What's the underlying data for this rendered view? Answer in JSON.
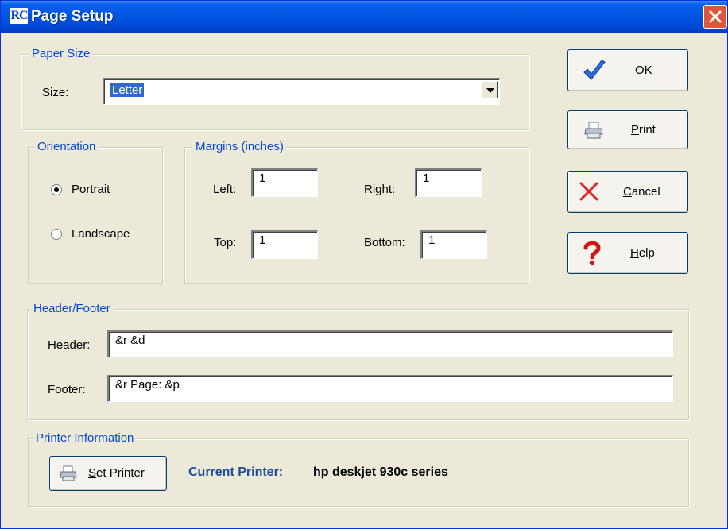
{
  "window": {
    "title": "Page Setup",
    "app_icon_text": "RC",
    "colors": {
      "titlebar": "#0054e3",
      "dialog_bg": "#ece9d8",
      "group_label": "#0046d5",
      "close": "#e0563a"
    }
  },
  "paper_size": {
    "legend": "Paper Size",
    "size_label": "Size:",
    "size_value": "Letter"
  },
  "orientation": {
    "legend": "Orientation",
    "options": [
      {
        "label": "Portrait",
        "selected": true
      },
      {
        "label": "Landscape",
        "selected": false
      }
    ]
  },
  "margins": {
    "legend": "Margins (inches)",
    "left_label": "Left:",
    "left_value": "1",
    "right_label": "Right:",
    "right_value": "1",
    "top_label": "Top:",
    "top_value": "1",
    "bottom_label": "Bottom:",
    "bottom_value": "1"
  },
  "header_footer": {
    "legend": "Header/Footer",
    "header_label": "Header:",
    "header_value": "&r &d",
    "footer_label": "Footer:",
    "footer_value": "&r Page: &p"
  },
  "printer_info": {
    "legend": "Printer Information",
    "set_printer_mnemonic": "S",
    "set_printer_rest": "et Printer",
    "current_label": "Current Printer:",
    "current_value": "hp deskjet 930c series"
  },
  "buttons": {
    "ok": {
      "mnemonic": "O",
      "rest": "K",
      "icon": "checkmark-icon"
    },
    "print": {
      "mnemonic": "P",
      "rest": "rint",
      "icon": "printer-icon"
    },
    "cancel": {
      "mnemonic": "C",
      "rest": "ancel",
      "icon": "x-icon"
    },
    "help": {
      "mnemonic": "H",
      "rest": "elp",
      "icon": "question-icon"
    }
  }
}
